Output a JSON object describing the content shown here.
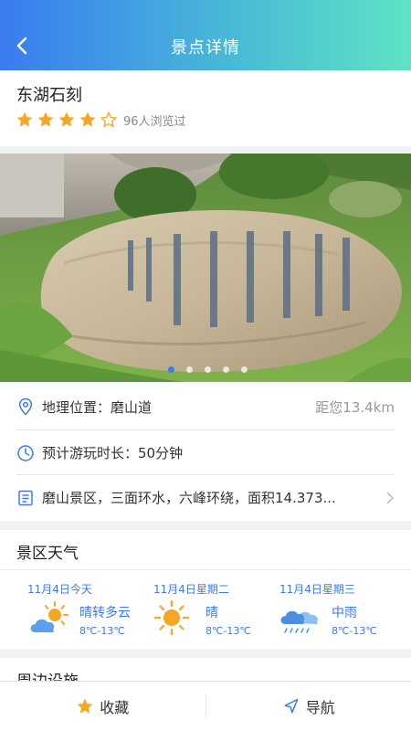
{
  "header": {
    "title": "景点详情",
    "back_icon": "chevron-left-icon"
  },
  "spot": {
    "name": "东湖石刻",
    "rating": 4,
    "rating_max": 5,
    "views": "96人浏览过"
  },
  "gallery": {
    "image_count": 5,
    "active_index": 0
  },
  "info": {
    "location_label": "地理位置：磨山道",
    "distance": "距您13.4km",
    "duration_label": "预计游玩时长：50分钟",
    "description": "磨山景区，三面环水，六峰环绕，面积14.373..."
  },
  "weather": {
    "title": "景区天气",
    "days": [
      {
        "date": "11月4日今天",
        "condition": "晴转多云",
        "temp": "8℃-13℃",
        "icon": "sun-cloud-icon"
      },
      {
        "date": "11月4日星期二",
        "condition": "晴",
        "temp": "8℃-13℃",
        "icon": "sun-icon"
      },
      {
        "date": "11月4日星期三",
        "condition": "中雨",
        "temp": "8℃-13℃",
        "icon": "rain-icon"
      }
    ]
  },
  "facilities": {
    "title": "周边设施"
  },
  "bottom_bar": {
    "favorite_label": "收藏",
    "navigate_label": "导航"
  },
  "colors": {
    "accent": "#3a7bf0",
    "star": "#f5a623",
    "header_start": "#3a7bf0",
    "header_end": "#5fe3c4"
  }
}
